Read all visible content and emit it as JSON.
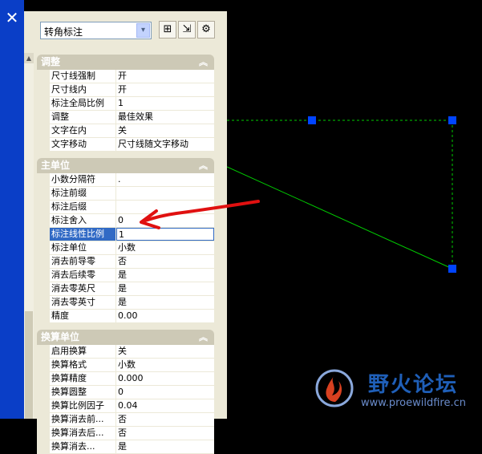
{
  "window": {
    "close_glyph": "✕"
  },
  "toolbar": {
    "style_select": "转角标注",
    "dropdown_glyph": "▾",
    "button1_glyph": "⊞",
    "button2_glyph": "⇲",
    "button3_glyph": "⚙"
  },
  "scroll": {
    "up_glyph": "▲"
  },
  "sections": [
    {
      "title": "调整",
      "collapse_glyph": "︽",
      "rows": [
        {
          "key": "尺寸线强制",
          "value": "开"
        },
        {
          "key": "尺寸线内",
          "value": "开"
        },
        {
          "key": "标注全局比例",
          "value": "1"
        },
        {
          "key": "调整",
          "value": "最佳效果"
        },
        {
          "key": "文字在内",
          "value": "关"
        },
        {
          "key": "文字移动",
          "value": "尺寸线随文字移动"
        }
      ]
    },
    {
      "title": "主单位",
      "collapse_glyph": "︽",
      "rows": [
        {
          "key": "小数分隔符",
          "value": "."
        },
        {
          "key": "标注前缀",
          "value": ""
        },
        {
          "key": "标注后缀",
          "value": ""
        },
        {
          "key": "标注舍入",
          "value": "0"
        },
        {
          "key": "标注线性比例",
          "value": "1"
        },
        {
          "key": "标注单位",
          "value": "小数"
        },
        {
          "key": "消去前导零",
          "value": "否"
        },
        {
          "key": "消去后续零",
          "value": "是"
        },
        {
          "key": "消去零英尺",
          "value": "是"
        },
        {
          "key": "消去零英寸",
          "value": "是"
        },
        {
          "key": "精度",
          "value": "0.00"
        }
      ]
    },
    {
      "title": "换算单位",
      "collapse_glyph": "︽",
      "rows": [
        {
          "key": "启用换算",
          "value": "关"
        },
        {
          "key": "换算格式",
          "value": "小数"
        },
        {
          "key": "换算精度",
          "value": "0.000"
        },
        {
          "key": "换算圆整",
          "value": "0"
        },
        {
          "key": "换算比例因子",
          "value": "0.04"
        },
        {
          "key": "换算消去前...",
          "value": "否"
        },
        {
          "key": "换算消去后...",
          "value": "否"
        },
        {
          "key": "换算消去...",
          "value": "是"
        }
      ]
    }
  ],
  "watermark": {
    "title": "野火论坛",
    "url": "www.proewildfire.cn"
  },
  "colors": {
    "dimension_line": "#00cc00",
    "grip": "#0044ff",
    "arrow": "#e01010",
    "selection": "#316ac5"
  }
}
